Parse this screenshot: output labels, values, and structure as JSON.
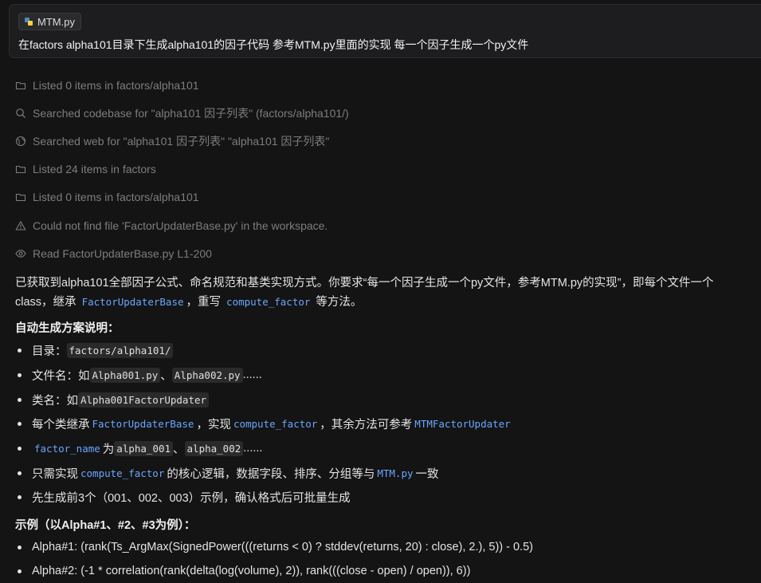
{
  "prompt": {
    "file_chip": "MTM.py",
    "text": "在factors alpha101目录下生成alpha101的因子代码  参考MTM.py里面的实现 每一个因子生成一个py文件"
  },
  "tool_calls": [
    {
      "icon": "folder-icon",
      "text": "Listed 0 items in factors/alpha101"
    },
    {
      "icon": "search-icon",
      "text": "Searched codebase for \"alpha101 因子列表\" (factors/alpha101/)"
    },
    {
      "icon": "globe-icon",
      "text": "Searched web for \"alpha101 因子列表\" \"alpha101 因子列表\""
    },
    {
      "icon": "folder-icon",
      "text": "Listed 24 items in factors"
    },
    {
      "icon": "folder-icon",
      "text": "Listed 0 items in factors/alpha101"
    },
    {
      "icon": "warning-icon",
      "text": "Could not find file 'FactorUpdaterBase.py' in the workspace."
    },
    {
      "icon": "eye-icon",
      "text": "Read FactorUpdaterBase.py L1-200"
    }
  ],
  "answer": {
    "intro_line1": "已获取到alpha101全部因子公式、命名规范和基类实现方式。你要求“每一个因子生成一个py文件，参考MTM.py的实现”，即每个文件一个",
    "intro_line2_a": "class，继承 ",
    "intro_line2_sym1": "FactorUpdaterBase",
    "intro_line2_b": "，重写 ",
    "intro_line2_sym2": "compute_factor",
    "intro_line2_c": " 等方法。",
    "heading1": "自动生成方案说明：",
    "b1_label": "目录：",
    "b1_code": "factors/alpha101/",
    "b2_label": "文件名：如",
    "b2_code1": "Alpha001.py",
    "b2_sep": "、",
    "b2_code2": "Alpha002.py",
    "b2_tail": "......",
    "b3_label": "类名：如",
    "b3_code": "Alpha001FactorUpdater",
    "b4_a": "每个类继承 ",
    "b4_sym1": "FactorUpdaterBase",
    "b4_b": "，实现 ",
    "b4_sym2": "compute_factor",
    "b4_c": "，其余方法可参考 ",
    "b4_sym3": "MTMFactorUpdater",
    "b5_sym": "factor_name",
    "b5_label": "为",
    "b5_code1": "alpha_001",
    "b5_sep": "、",
    "b5_code2": "alpha_002",
    "b5_tail": "......",
    "b6_a": "只需实现 ",
    "b6_sym1": "compute_factor",
    "b6_b": " 的核心逻辑，数据字段、排序、分组等与 ",
    "b6_sym2": "MTM.py",
    "b6_c": "一致",
    "b7": "先生成前3个（001、002、003）示例，确认格式后可批量生成",
    "heading2": "示例（以Alpha#1、#2、#3为例）：",
    "ex1": "Alpha#1: (rank(Ts_ArgMax(SignedPower(((returns < 0) ? stddev(returns, 20) : close), 2.), 5)) - 0.5)",
    "ex2": "Alpha#2: (-1 * correlation(rank(delta(log(volume), 2)), rank(((close - open) / open)), 6))"
  }
}
